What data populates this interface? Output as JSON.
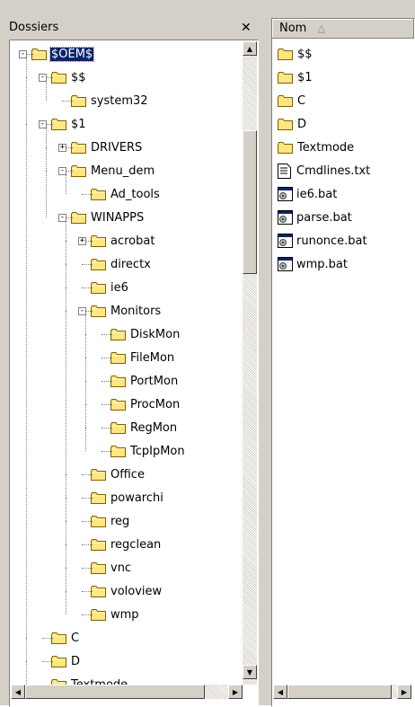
{
  "tree_panel": {
    "title": "Dossiers",
    "close_glyph": "✕",
    "items": [
      {
        "label": "$OEM$"
      },
      {
        "label": "$$"
      },
      {
        "label": "system32"
      },
      {
        "label": "$1"
      },
      {
        "label": "DRIVERS"
      },
      {
        "label": "Menu_dem"
      },
      {
        "label": "Ad_tools"
      },
      {
        "label": "WINAPPS"
      },
      {
        "label": "acrobat"
      },
      {
        "label": "directx"
      },
      {
        "label": "ie6"
      },
      {
        "label": "Monitors"
      },
      {
        "label": "DiskMon"
      },
      {
        "label": "FileMon"
      },
      {
        "label": "PortMon"
      },
      {
        "label": "ProcMon"
      },
      {
        "label": "RegMon"
      },
      {
        "label": "TcpIpMon"
      },
      {
        "label": "Office"
      },
      {
        "label": "powarchi"
      },
      {
        "label": "reg"
      },
      {
        "label": "regclean"
      },
      {
        "label": "vnc"
      },
      {
        "label": "voloview"
      },
      {
        "label": "wmp"
      },
      {
        "label": "C"
      },
      {
        "label": "D"
      },
      {
        "label": "Textmode"
      }
    ]
  },
  "list_panel": {
    "column_header": "Nom",
    "sort_glyph": "△",
    "items": [
      {
        "label": "$$",
        "icon": "folder-icon"
      },
      {
        "label": "$1",
        "icon": "folder-icon"
      },
      {
        "label": "C",
        "icon": "folder-icon"
      },
      {
        "label": "D",
        "icon": "folder-icon"
      },
      {
        "label": "Textmode",
        "icon": "folder-icon"
      },
      {
        "label": "Cmdlines.txt",
        "icon": "text-file-icon"
      },
      {
        "label": "ie6.bat",
        "icon": "batch-file-icon"
      },
      {
        "label": "parse.bat",
        "icon": "batch-file-icon"
      },
      {
        "label": "runonce.bat",
        "icon": "batch-file-icon"
      },
      {
        "label": "wmp.bat",
        "icon": "batch-file-icon"
      }
    ]
  },
  "colors": {
    "selection": "#0a246a",
    "folder_fill": "#ffe680",
    "window_face": "#d4d0c8"
  }
}
